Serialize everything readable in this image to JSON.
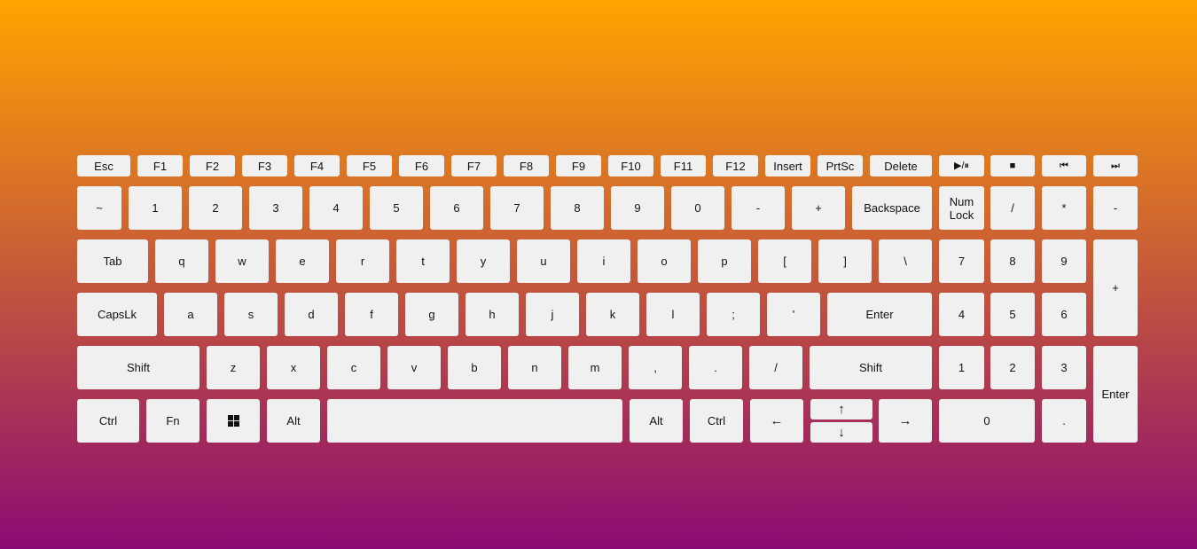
{
  "keyboard": {
    "row_fn": [
      "Esc",
      "F1",
      "F2",
      "F3",
      "F4",
      "F5",
      "F6",
      "F7",
      "F8",
      "F9",
      "F10",
      "F11",
      "F12",
      "Insert",
      "PrtSc",
      "Delete"
    ],
    "media": {
      "play_pause": "▶/⏸",
      "stop": "■",
      "prev": "⏮",
      "next": "⏭"
    },
    "row_num": [
      "~",
      "1",
      "2",
      "3",
      "4",
      "5",
      "6",
      "7",
      "8",
      "9",
      "0",
      "-",
      "+",
      "Backspace"
    ],
    "numpad_top": [
      "Num\nLock",
      "/",
      "*",
      "-"
    ],
    "row_tab": [
      "Tab",
      "q",
      "w",
      "e",
      "r",
      "t",
      "y",
      "u",
      "i",
      "o",
      "p",
      "[",
      "]",
      "\\"
    ],
    "numpad_789": [
      "7",
      "8",
      "9"
    ],
    "numpad_plus": "+",
    "row_caps": [
      "CapsLk",
      "a",
      "s",
      "d",
      "f",
      "g",
      "h",
      "j",
      "k",
      "l",
      ";",
      "'",
      "Enter"
    ],
    "numpad_456": [
      "4",
      "5",
      "6"
    ],
    "row_shift": [
      "Shift",
      "z",
      "x",
      "c",
      "v",
      "b",
      "n",
      "m",
      ",",
      ".",
      "/",
      "Shift"
    ],
    "numpad_123": [
      "1",
      "2",
      "3"
    ],
    "numpad_enter": "Enter",
    "row_bottom": [
      "Ctrl",
      "Fn",
      "",
      "Alt",
      "",
      "Alt",
      "Ctrl"
    ],
    "arrows": {
      "left": "←",
      "up": "↑",
      "down": "↓",
      "right": "→"
    },
    "numpad_0": "0",
    "numpad_dot": "."
  },
  "colors": {
    "key": "#f0f0f0",
    "gradient_top": "#ffa500",
    "gradient_bottom": "#8b0b74"
  }
}
